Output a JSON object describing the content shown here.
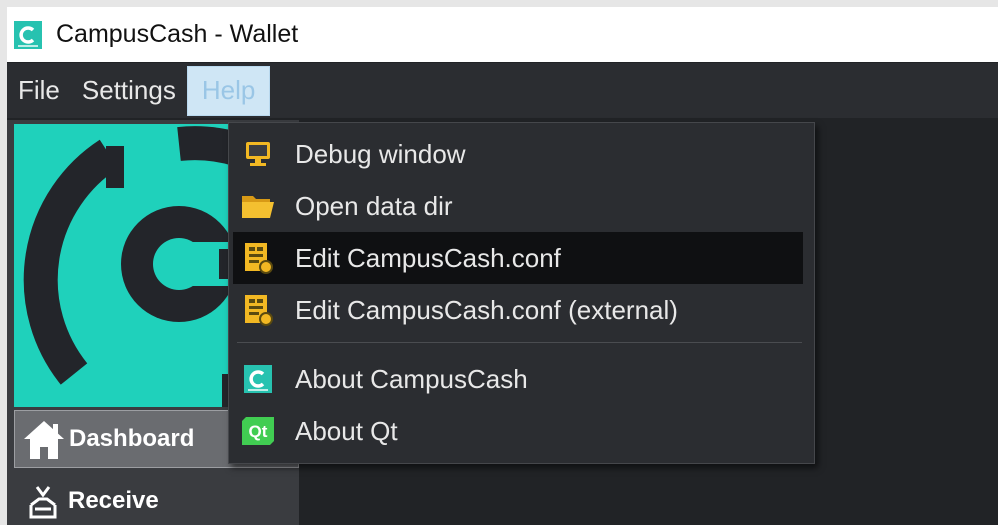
{
  "window": {
    "title": "CampusCash - Wallet"
  },
  "menubar": {
    "items": [
      {
        "label": "File"
      },
      {
        "label": "Settings"
      },
      {
        "label": "Help"
      }
    ]
  },
  "help_menu": {
    "items": [
      {
        "label": "Debug window",
        "icon": "monitor-icon"
      },
      {
        "label": "Open data dir",
        "icon": "folder-icon"
      },
      {
        "label": "Edit CampusCash.conf",
        "icon": "config-file-icon",
        "highlighted": true
      },
      {
        "label": "Edit CampusCash.conf (external)",
        "icon": "config-file-icon"
      },
      {
        "label": "About CampusCash",
        "icon": "campuscash-logo-icon"
      },
      {
        "label": "About Qt",
        "icon": "qt-logo-icon",
        "badge": "Qt"
      }
    ]
  },
  "sidebar": {
    "nav": [
      {
        "label": "Dashboard",
        "icon": "home-icon"
      },
      {
        "label": "Receive",
        "icon": "receive-icon"
      }
    ]
  },
  "colors": {
    "brand": "#1fd1bb",
    "background": "#212326",
    "menu_bg": "#2b2d31",
    "highlight": "#0f1012"
  }
}
